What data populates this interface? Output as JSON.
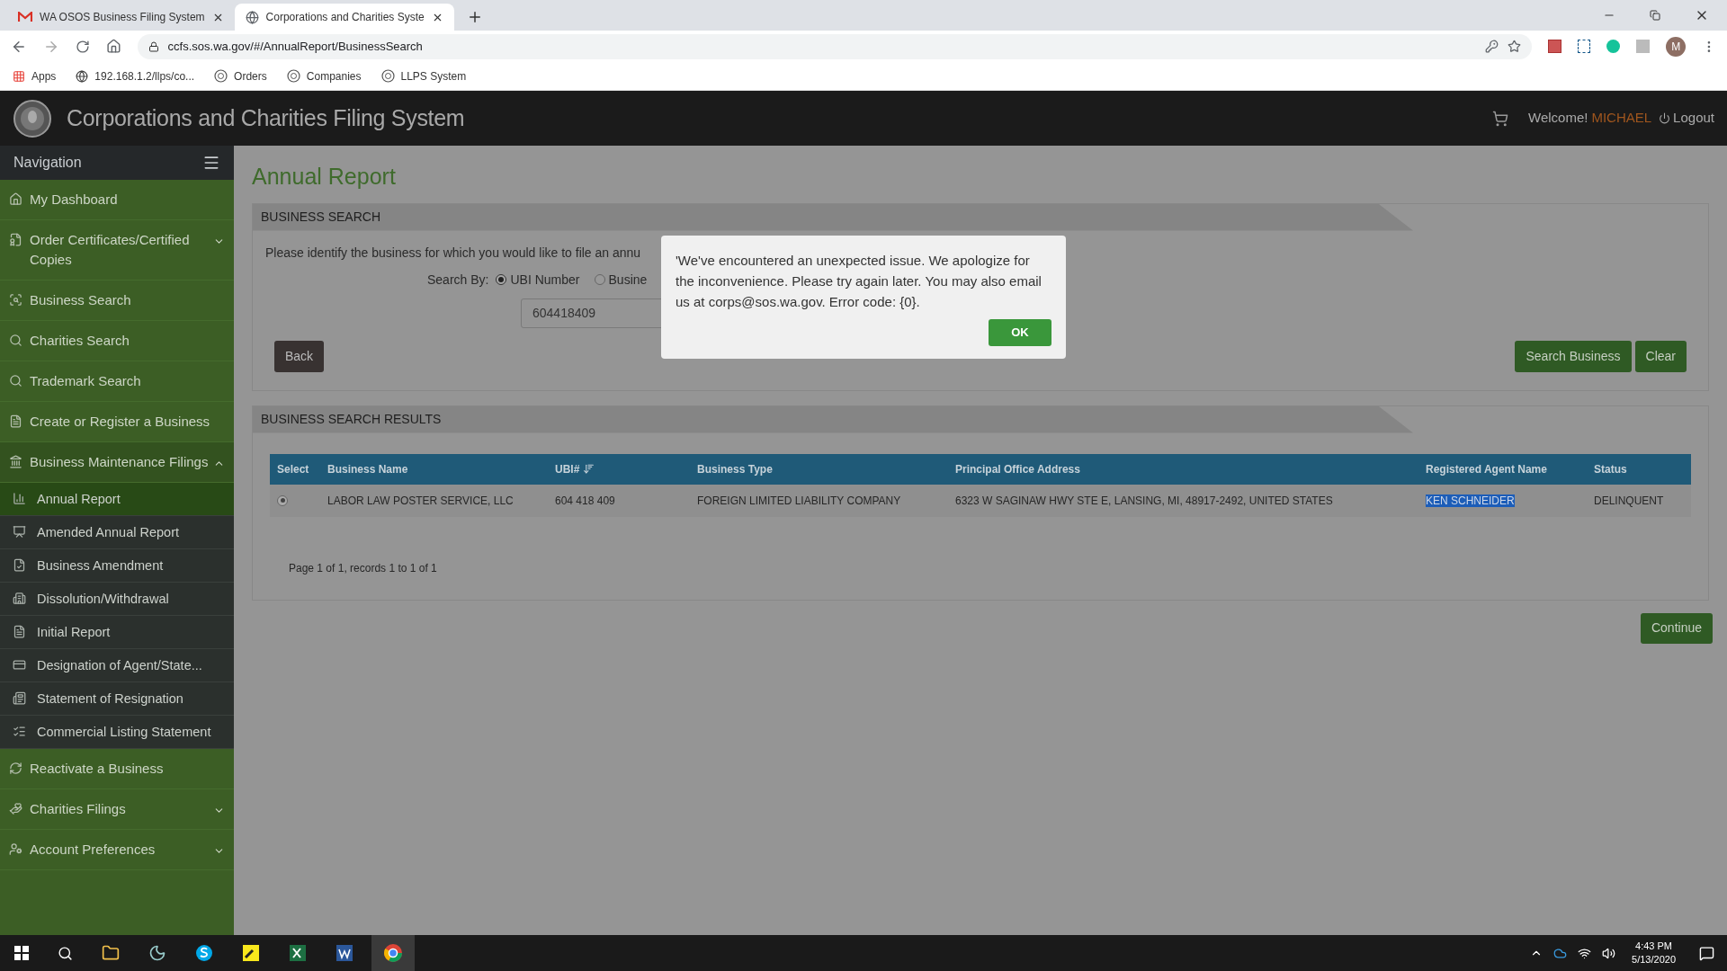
{
  "browser": {
    "tabs": [
      {
        "title": "WA OSOS Business Filing System",
        "kind": "mail",
        "selected": false
      },
      {
        "title": "Corporations and Charities Syste",
        "kind": "globe",
        "selected": true
      }
    ],
    "url": "ccfs.sos.wa.gov/#/AnnualReport/BusinessSearch",
    "profile": "M",
    "bookmarks": [
      {
        "label": "Apps",
        "kind": "apps"
      },
      {
        "label": "192.168.1.2/llps/co...",
        "kind": "globe"
      },
      {
        "label": "Orders",
        "kind": "seal"
      },
      {
        "label": "Companies",
        "kind": "seal"
      },
      {
        "label": "LLPS System",
        "kind": "seal"
      }
    ]
  },
  "header": {
    "title": "Corporations and Charities Filing System",
    "welcome": "Welcome!",
    "user": "MICHAEL",
    "logout": "Logout"
  },
  "sidebar": {
    "title": "Navigation",
    "items": [
      {
        "label": "My Dashboard"
      },
      {
        "label": "Order Certificates/Certified Copies",
        "expanded": false
      },
      {
        "label": "Business Search"
      },
      {
        "label": "Charities Search"
      },
      {
        "label": "Trademark Search"
      },
      {
        "label": "Create or Register a Business"
      },
      {
        "label": "Business Maintenance Filings",
        "expanded": true,
        "children": [
          {
            "label": "Annual Report",
            "selected": true
          },
          {
            "label": "Amended Annual Report",
            "selected": false
          },
          {
            "label": "Business Amendment",
            "selected": false
          },
          {
            "label": "Dissolution/Withdrawal",
            "selected": false
          },
          {
            "label": "Initial Report",
            "selected": false
          },
          {
            "label": "Designation of Agent/State...",
            "selected": false
          },
          {
            "label": "Statement of Resignation",
            "selected": false
          },
          {
            "label": "Commercial Listing Statement",
            "selected": false
          }
        ]
      },
      {
        "label": "Reactivate a Business"
      },
      {
        "label": "Charities Filings",
        "expanded": false
      },
      {
        "label": "Account Preferences",
        "expanded": false
      }
    ]
  },
  "page_title": "Annual Report",
  "search_panel": {
    "title": "BUSINESS SEARCH",
    "instruction": "Please identify the business for which you would like to file an annu",
    "search_by": "Search By:",
    "options": [
      {
        "label": "UBI Number",
        "selected": true
      },
      {
        "label": "Busine",
        "selected": false
      }
    ],
    "ubi_value": "604418409",
    "buttons": [
      {
        "label": "Back",
        "kind": "dark"
      },
      {
        "label": "Search Business",
        "kind": "green"
      },
      {
        "label": "Clear",
        "kind": "green"
      }
    ]
  },
  "results_panel": {
    "title": "BUSINESS SEARCH RESULTS",
    "columns": [
      "Select",
      "Business Name",
      "UBI#",
      "Business Type",
      "Principal Office Address",
      "Registered Agent Name",
      "Status"
    ],
    "rows": [
      {
        "cells": [
          {
            "kind": "radio",
            "selected": true
          },
          {
            "text": "LABOR LAW POSTER SERVICE, LLC",
            "highlighted": false
          },
          {
            "text": "604 418 409",
            "highlighted": false
          },
          {
            "text": "FOREIGN LIMITED LIABILITY COMPANY",
            "highlighted": false
          },
          {
            "text": "6323 W SAGINAW HWY STE E, LANSING, MI, 48917-2492, UNITED STATES",
            "highlighted": false
          },
          {
            "text": "KEN SCHNEIDER",
            "highlighted": true
          },
          {
            "text": "DELINQUENT",
            "highlighted": false
          }
        ]
      }
    ],
    "pager": "Page 1 of 1, records 1 to 1 of 1"
  },
  "continue": "Continue",
  "dialog": {
    "message": "'We've encountered an unexpected issue. We apologize for the inconvenience. Please try again later. You may also email us at corps@sos.wa.gov. Error code: {0}.",
    "ok": "OK"
  },
  "taskbar": {
    "time": "4:43 PM",
    "date": "5/13/2020"
  }
}
